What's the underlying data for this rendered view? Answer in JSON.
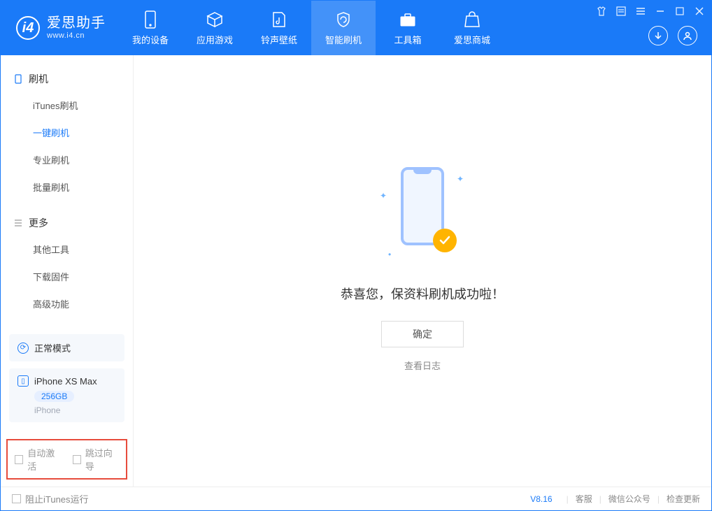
{
  "app": {
    "name_cn": "爱思助手",
    "name_en": "www.i4.cn"
  },
  "tabs": [
    {
      "id": "device",
      "label": "我的设备"
    },
    {
      "id": "apps",
      "label": "应用游戏"
    },
    {
      "id": "media",
      "label": "铃声壁纸"
    },
    {
      "id": "flash",
      "label": "智能刷机",
      "active": true
    },
    {
      "id": "tools",
      "label": "工具箱"
    },
    {
      "id": "store",
      "label": "爱思商城"
    }
  ],
  "sidebar": {
    "sections": [
      {
        "id": "flash",
        "title": "刷机",
        "items": [
          {
            "id": "itunes",
            "label": "iTunes刷机"
          },
          {
            "id": "oneclick",
            "label": "一键刷机",
            "active": true
          },
          {
            "id": "pro",
            "label": "专业刷机"
          },
          {
            "id": "batch",
            "label": "批量刷机"
          }
        ]
      },
      {
        "id": "more",
        "title": "更多",
        "items": [
          {
            "id": "other",
            "label": "其他工具"
          },
          {
            "id": "fw",
            "label": "下载固件"
          },
          {
            "id": "adv",
            "label": "高级功能"
          }
        ]
      }
    ],
    "mode": {
      "label": "正常模式"
    },
    "device": {
      "name": "iPhone XS Max",
      "capacity": "256GB",
      "type": "iPhone"
    },
    "options": {
      "auto_activate": "自动激活",
      "skip_guide": "跳过向导"
    }
  },
  "main": {
    "success_text": "恭喜您，保资料刷机成功啦！",
    "ok_label": "确定",
    "view_log": "查看日志"
  },
  "footer": {
    "block_itunes": "阻止iTunes运行",
    "version": "V8.16",
    "links": {
      "service": "客服",
      "wechat": "微信公众号",
      "update": "检查更新"
    }
  }
}
